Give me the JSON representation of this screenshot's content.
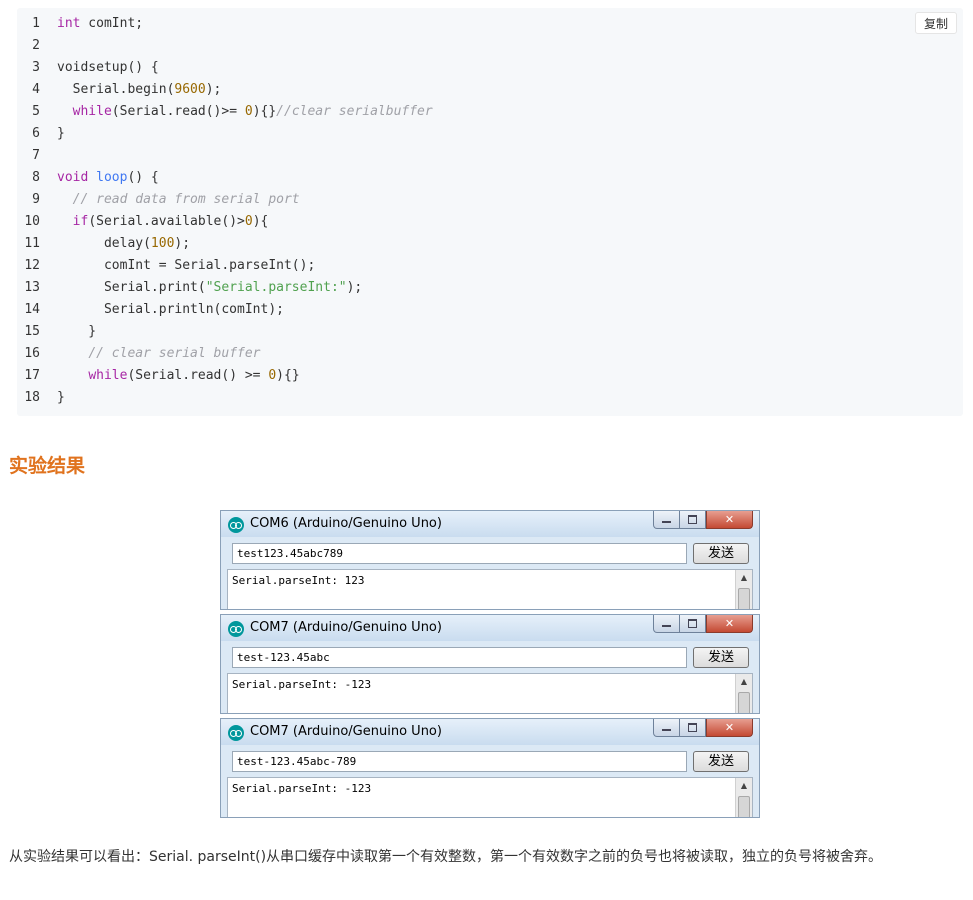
{
  "code": {
    "copy_label": "复制",
    "lines": [
      {
        "n": "1",
        "segments": [
          {
            "t": "kw",
            "s": "int"
          },
          {
            "t": "pl",
            "s": " comInt;"
          }
        ]
      },
      {
        "n": "2",
        "segments": []
      },
      {
        "n": "3",
        "segments": [
          {
            "t": "pl",
            "s": "voidsetup() {"
          }
        ]
      },
      {
        "n": "4",
        "segments": [
          {
            "t": "pl",
            "s": "  Serial.begin("
          },
          {
            "t": "num",
            "s": "9600"
          },
          {
            "t": "pl",
            "s": ");"
          }
        ]
      },
      {
        "n": "5",
        "segments": [
          {
            "t": "pl",
            "s": "  "
          },
          {
            "t": "kw",
            "s": "while"
          },
          {
            "t": "pl",
            "s": "(Serial.read()>= "
          },
          {
            "t": "num",
            "s": "0"
          },
          {
            "t": "pl",
            "s": "){}"
          },
          {
            "t": "cm",
            "s": "//clear serialbuffer"
          }
        ]
      },
      {
        "n": "6",
        "segments": [
          {
            "t": "pl",
            "s": "}"
          }
        ]
      },
      {
        "n": "7",
        "segments": []
      },
      {
        "n": "8",
        "segments": [
          {
            "t": "kw",
            "s": "void"
          },
          {
            "t": "pl",
            "s": " "
          },
          {
            "t": "fn",
            "s": "loop"
          },
          {
            "t": "pl",
            "s": "() {"
          }
        ]
      },
      {
        "n": "9",
        "segments": [
          {
            "t": "pl",
            "s": "  "
          },
          {
            "t": "cm",
            "s": "// read data from serial port"
          }
        ]
      },
      {
        "n": "10",
        "segments": [
          {
            "t": "pl",
            "s": "  "
          },
          {
            "t": "kw",
            "s": "if"
          },
          {
            "t": "pl",
            "s": "(Serial.available()>"
          },
          {
            "t": "num",
            "s": "0"
          },
          {
            "t": "pl",
            "s": "){"
          }
        ]
      },
      {
        "n": "11",
        "segments": [
          {
            "t": "pl",
            "s": "      delay("
          },
          {
            "t": "num",
            "s": "100"
          },
          {
            "t": "pl",
            "s": ");"
          }
        ]
      },
      {
        "n": "12",
        "segments": [
          {
            "t": "pl",
            "s": "      comInt = Serial.parseInt();"
          }
        ]
      },
      {
        "n": "13",
        "segments": [
          {
            "t": "pl",
            "s": "      Serial.print("
          },
          {
            "t": "str",
            "s": "\"Serial.parseInt:\""
          },
          {
            "t": "pl",
            "s": ");"
          }
        ]
      },
      {
        "n": "14",
        "segments": [
          {
            "t": "pl",
            "s": "      Serial.println(comInt);"
          }
        ]
      },
      {
        "n": "15",
        "segments": [
          {
            "t": "pl",
            "s": "    }"
          }
        ]
      },
      {
        "n": "16",
        "segments": [
          {
            "t": "pl",
            "s": "    "
          },
          {
            "t": "cm",
            "s": "// clear serial buffer"
          }
        ]
      },
      {
        "n": "17",
        "segments": [
          {
            "t": "pl",
            "s": "    "
          },
          {
            "t": "kw",
            "s": "while"
          },
          {
            "t": "pl",
            "s": "(Serial.read() >= "
          },
          {
            "t": "num",
            "s": "0"
          },
          {
            "t": "pl",
            "s": "){}"
          }
        ]
      },
      {
        "n": "18",
        "segments": [
          {
            "t": "pl",
            "s": "}"
          }
        ]
      }
    ]
  },
  "heading": "实验结果",
  "monitors": [
    {
      "title": "COM6 (Arduino/Genuino Uno)",
      "input": "test123.45abc789",
      "send": "发送",
      "output": "Serial.parseInt: 123"
    },
    {
      "title": "COM7 (Arduino/Genuino Uno)",
      "input": "test-123.45abc",
      "send": "发送",
      "output": "Serial.parseInt: -123"
    },
    {
      "title": "COM7 (Arduino/Genuino Uno)",
      "input": "test-123.45abc-789",
      "send": "发送",
      "output": "Serial.parseInt: -123"
    }
  ],
  "conclusion": "从实验结果可以看出：Serial. parseInt()从串口缓存中读取第一个有效整数，第一个有效数字之前的负号也将被读取，独立的负号将被舍弃。",
  "colors": {
    "heading": "#e0731e",
    "keyword": "#a626a4",
    "number": "#986801",
    "string": "#50a14f",
    "comment": "#a0a1a7",
    "function": "#4078f2"
  }
}
